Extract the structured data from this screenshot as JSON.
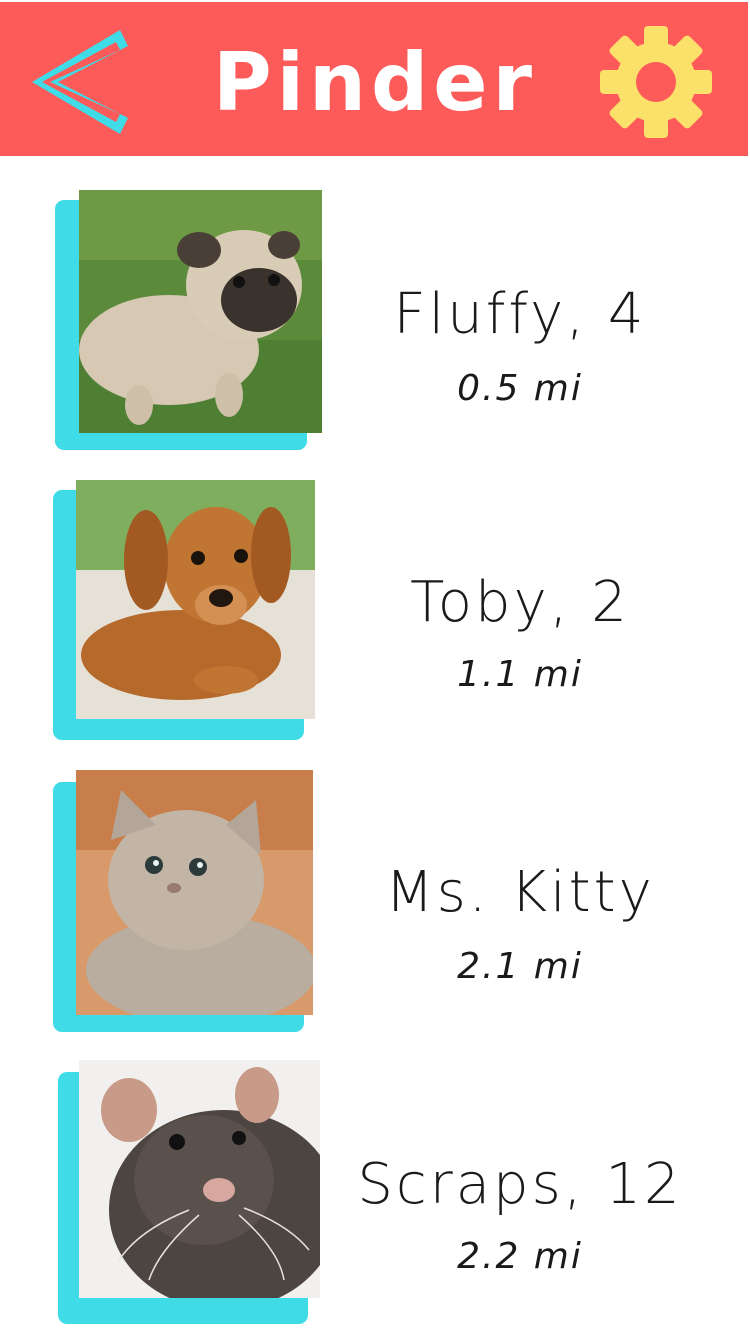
{
  "header": {
    "title": "Pinder",
    "back_icon": "chevron-left-icon",
    "settings_icon": "gear-icon",
    "colors": {
      "background": "#fd5b5a",
      "back_icon": "#3fdbe6",
      "settings_icon": "#fbe06a",
      "title": "#ffffff"
    }
  },
  "pets": [
    {
      "name": "Fluffy, 4",
      "distance": "0.5 mi",
      "animal": "pug puppy"
    },
    {
      "name": "Toby, 2",
      "distance": "1.1 mi",
      "animal": "dachshund puppy"
    },
    {
      "name": "Ms. Kitty",
      "distance": "2.1 mi",
      "animal": "grey kitten"
    },
    {
      "name": "Scraps, 12",
      "distance": "2.2 mi",
      "animal": "brown rat"
    }
  ],
  "colors": {
    "photo_accent": "#3fdbe6",
    "text": "#1a1a1a"
  }
}
